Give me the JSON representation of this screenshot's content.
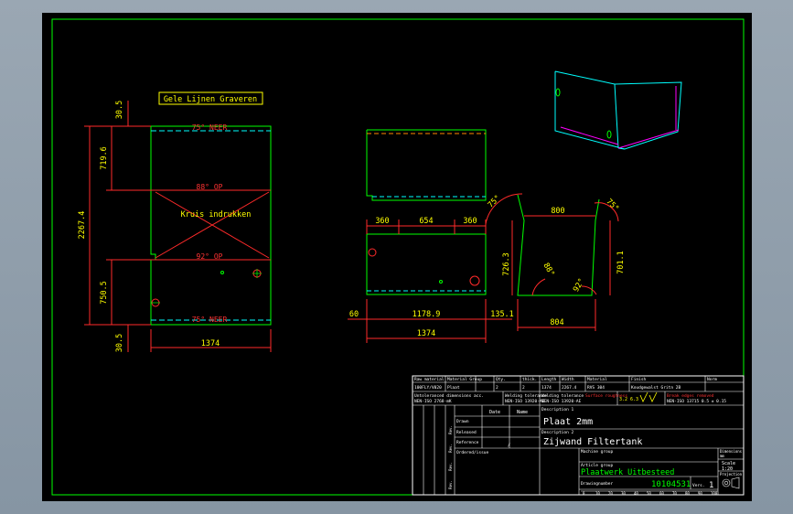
{
  "colors": {
    "background": "#000000",
    "frame": "#00ff00",
    "part_outline": "#00ff00",
    "dimension": "#ff2a2a",
    "text": "#ffff00",
    "hidden_edge": "#00ffff",
    "bend_text": "#ff3333",
    "iso_outline": "#00ffff",
    "iso_inner": "#ff00ff"
  },
  "front_view": {
    "annotation_box": "Gele Lijnen Graveren",
    "top_bend_label": "75° NEER",
    "middle_bend_label": "88° OP",
    "cross_label": "Kruis indrukken",
    "lower_bend_label": "92° OP",
    "bottom_bend_label": "75° NEER",
    "dim_top_flange": "30.5",
    "dim_upper": "719.6",
    "dim_total_height": "2267.4",
    "dim_lower": "750.5",
    "dim_bottom_flange": "30.5",
    "dim_width": "1374"
  },
  "top_view": {
    "dim_left": "360",
    "dim_mid": "654",
    "dim_right": "360",
    "dim_left_flange": "60",
    "dim_body": "1178.9",
    "dim_right_flange": "135.1",
    "dim_total": "1374"
  },
  "side_view": {
    "angle_top_left": "75°",
    "angle_top_right": "75°",
    "angle_left_inner": "88°",
    "angle_right_inner": "92°",
    "dim_top": "800",
    "dim_left": "726.3",
    "dim_right": "701.1",
    "dim_bottom": "804"
  },
  "title_block": {
    "headers": [
      "Raw material",
      "Material Group",
      "Qty.",
      "thick.",
      "Length",
      "Width",
      "Material",
      "Finish",
      "Norm"
    ],
    "values": [
      "100FLY/V020",
      "Plaat",
      "2",
      "2",
      "1374",
      "2267.4",
      "RVS 304",
      "Koudgewalst Gritn 2B",
      ""
    ],
    "tolerance_general": "Untoleranced dimensions acc.",
    "tolerance_spec": "NEN-ISO 2768-mK",
    "welding_label": "Welding tolerance",
    "welding_spec": "NEN-ISO 13920-AE",
    "surface_label": "Surface roughness",
    "surface_values": "3.2  6.3",
    "edges_label": "Break edges removed",
    "edges_spec": "NEN-ISO 13715  0.5 ± 0.15",
    "rev_headers": [
      "Date",
      "Name"
    ],
    "rev_rows": [
      "Drawn",
      "Released",
      "Reference",
      "Ordered/issue"
    ],
    "rev_extra": "/",
    "rev_side_labels": [
      "Rev.",
      "Rev.",
      "Rev.",
      "Rev."
    ],
    "desc1_label": "Description 1",
    "desc1": "Plaat 2mm",
    "desc2_label": "Description 2",
    "desc2": "Zijwand Filtertank",
    "machine_group_label": "Machine group",
    "article_group_label": "Article group",
    "article_group": "Plaatwerk Uitbesteed",
    "drawing_number_label": "Drawingnumber",
    "drawing_number": "10104531",
    "version_label": "Vers.",
    "version": "1",
    "dimensions_label": "Dimensions",
    "dimensions": "mm",
    "scale_label": "Scale",
    "scale": "1:20",
    "projection_label": "Projection",
    "ruler_ticks": [
      "0",
      "10",
      "20",
      "30",
      "40",
      "50",
      "60",
      "70",
      "80",
      "90",
      "100"
    ]
  }
}
